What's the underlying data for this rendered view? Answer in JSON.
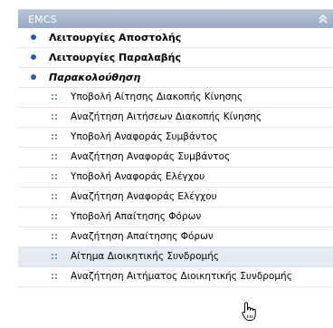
{
  "header": {
    "title": "EMCS",
    "collapse_icon": "double-chevron-up-icon"
  },
  "menu": {
    "top_items": [
      {
        "label": "Λειτουργίες Αποστολής"
      },
      {
        "label": "Λειτουργίες Παραλαβής"
      },
      {
        "label": "Παρακολούθηση"
      }
    ],
    "sub_items": [
      {
        "label": "Υποβολή Αίτησης Διακοπής Κίνησης"
      },
      {
        "label": "Αναζήτηση Αιτήσεων Διακοπής Κίνησης"
      },
      {
        "label": "Υποβολή Αναφοράς Συμβάντος"
      },
      {
        "label": "Αναζήτηση Αναφοράς Συμβάντος"
      },
      {
        "label": "Υποβολή Αναφοράς Ελέγχου"
      },
      {
        "label": "Αναζήτηση Αναφοράς Ελέγχου"
      },
      {
        "label": "Υποβολή Απαίτησης Φόρων"
      },
      {
        "label": "Αναζήτηση Απαίτησης Φόρων"
      },
      {
        "label": "Αίτημα Διοικητικής Συνδρομής"
      },
      {
        "label": "Αναζήτηση Αιτήματος Διοικητικής Συνδρομής"
      }
    ]
  },
  "colors": {
    "header_bg": "#a9b7cf",
    "bullet": "#2a5aa8",
    "highlight_row": "#e4e9f2"
  }
}
